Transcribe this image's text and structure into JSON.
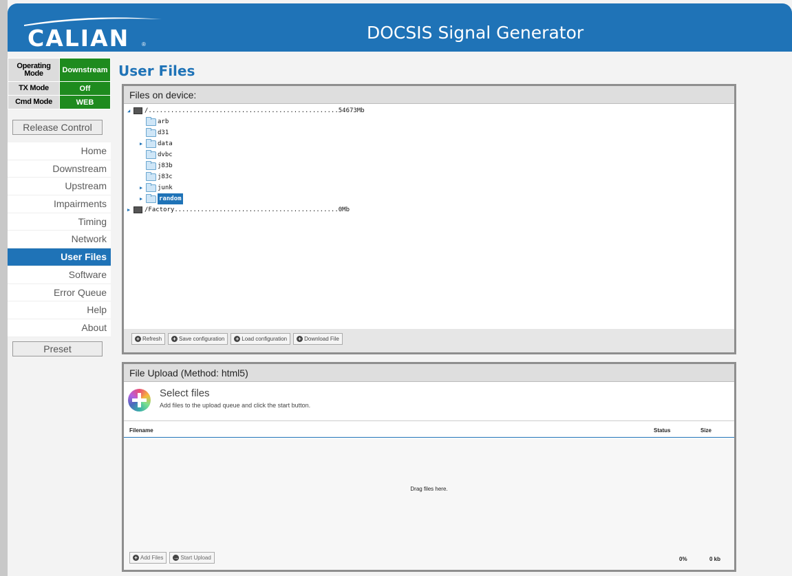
{
  "header": {
    "logo_text": "CALIAN",
    "logo_mark": "®",
    "title": "DOCSIS Signal Generator",
    "bg_color": "#1f73b7"
  },
  "status": [
    {
      "key": "Operating Mode",
      "value": "Downstream"
    },
    {
      "key": "TX Mode",
      "value": "Off"
    },
    {
      "key": "Cmd Mode",
      "value": "WEB"
    }
  ],
  "status_color": "#1e8b1e",
  "sidebar": {
    "release_label": "Release Control",
    "preset_label": "Preset",
    "items": [
      {
        "label": "Home"
      },
      {
        "label": "Downstream"
      },
      {
        "label": "Upstream"
      },
      {
        "label": "Impairments"
      },
      {
        "label": "Timing"
      },
      {
        "label": "Network"
      },
      {
        "label": "User Files",
        "active": true
      },
      {
        "label": "Software"
      },
      {
        "label": "Error Queue"
      },
      {
        "label": "Help"
      },
      {
        "label": "About"
      }
    ]
  },
  "page_title": "User Files",
  "files_panel": {
    "title": "Files on device:",
    "tree": [
      {
        "label": "/...................................................54673Mb",
        "icon": "drive-icon",
        "arrow": "expanded"
      },
      {
        "label": "arb",
        "icon": "folder-icon"
      },
      {
        "label": "d31",
        "icon": "folder-icon"
      },
      {
        "label": "data",
        "icon": "folder-icon",
        "arrow": "collapsed"
      },
      {
        "label": "dvbc",
        "icon": "folder-icon"
      },
      {
        "label": "j83b",
        "icon": "folder-icon"
      },
      {
        "label": "j83c",
        "icon": "folder-icon"
      },
      {
        "label": "junk",
        "icon": "folder-icon",
        "arrow": "collapsed"
      },
      {
        "label": "random",
        "icon": "folder-icon",
        "arrow": "collapsed",
        "selected": true
      },
      {
        "label": "/Factory............................................0Mb",
        "icon": "drive-icon",
        "arrow": "collapsed"
      }
    ],
    "buttons": {
      "refresh": "Refresh",
      "save": "Save configuration",
      "load": "Load configuration",
      "download": "Download File"
    }
  },
  "upload_panel": {
    "title": "File Upload (Method: html5)",
    "select_title": "Select files",
    "select_sub": "Add files to the upload queue and click the start button.",
    "columns": {
      "filename": "Filename",
      "status": "Status",
      "size": "Size"
    },
    "drop_text": "Drag files here.",
    "add_files": "Add Files",
    "start_upload": "Start Upload",
    "progress": "0%",
    "total_size": "0 kb"
  }
}
